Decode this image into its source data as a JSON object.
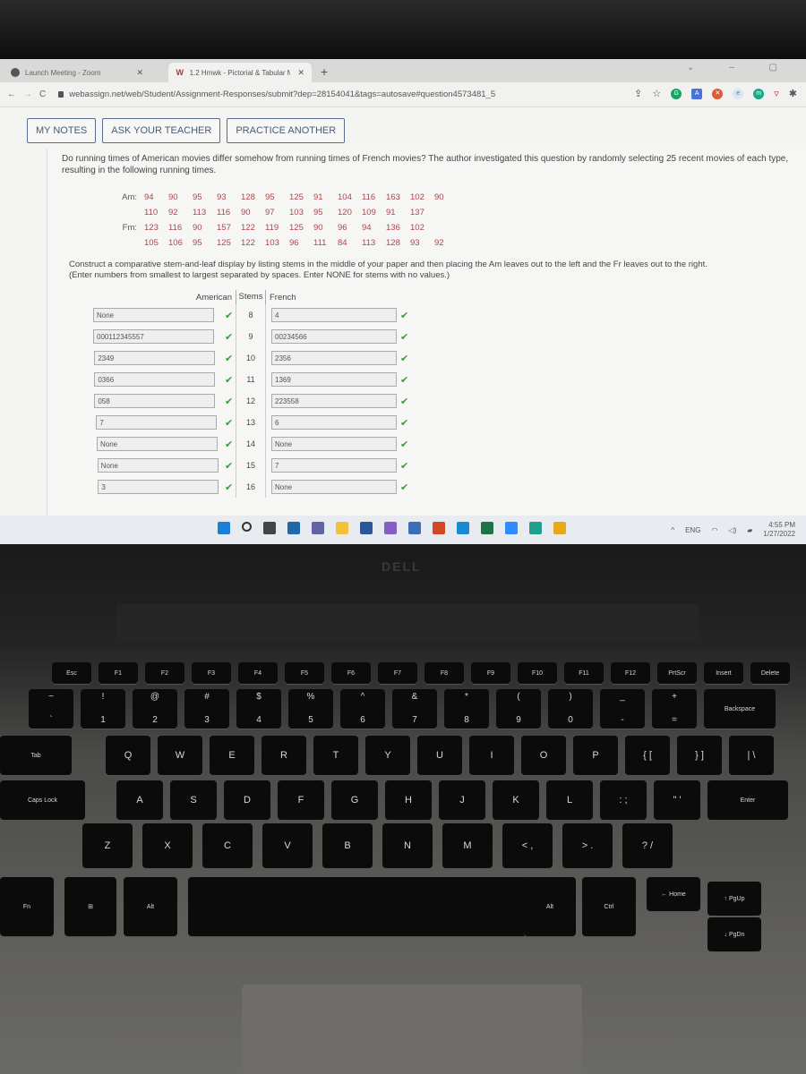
{
  "browser": {
    "tabs": [
      {
        "label": "Launch Meeting - Zoom",
        "active": false
      },
      {
        "label": "1.2 Hmwk - Pictorial & Tabular M",
        "active": true
      }
    ],
    "new_tab": "+",
    "url": "webassign.net/web/Student/Assignment-Responses/submit?dep=28154041&tags=autosave#question4573481_5",
    "extension_colors": [
      "#1aa260",
      "#4a73d9",
      "#e05a3a",
      "#7a9ad6",
      "#1aa88a",
      "#c0394a"
    ]
  },
  "toolbar": {
    "my_notes": "MY NOTES",
    "ask_teacher": "ASK YOUR TEACHER",
    "practice_another": "PRACTICE ANOTHER"
  },
  "question": {
    "text": "Do running times of American movies differ somehow from running times of French movies? The author investigated this question by randomly selecting 25 recent movies of each type, resulting in the following running times.",
    "am_label": "Am:",
    "fm_label": "Fm:",
    "am_rows": [
      [
        "94",
        "90",
        "95",
        "93",
        "128",
        "95",
        "125",
        "91",
        "104",
        "116",
        "163",
        "102",
        "90"
      ],
      [
        "110",
        "92",
        "113",
        "116",
        "90",
        "97",
        "103",
        "95",
        "120",
        "109",
        "91",
        "137"
      ]
    ],
    "fm_rows": [
      [
        "123",
        "116",
        "90",
        "157",
        "122",
        "119",
        "125",
        "90",
        "96",
        "94",
        "136",
        "102"
      ],
      [
        "105",
        "106",
        "95",
        "125",
        "122",
        "103",
        "96",
        "111",
        "84",
        "113",
        "128",
        "93",
        "92"
      ]
    ],
    "instructions": "Construct a comparative stem-and-leaf display by listing stems in the middle of your paper and then placing the Am leaves out to the left and the Fr leaves out to the right.",
    "instructions_note": "(Enter numbers from smallest to largest separated by spaces. Enter NONE for stems with no values.)"
  },
  "stemleaf": {
    "headers": {
      "american": "American",
      "stems": "Stems",
      "french": "French"
    },
    "rows": [
      {
        "american": "None",
        "stem": "8",
        "french": "4"
      },
      {
        "american": "000112345557",
        "stem": "9",
        "french": "00234566"
      },
      {
        "american": "2349",
        "stem": "10",
        "french": "2356"
      },
      {
        "american": "0366",
        "stem": "11",
        "french": "1369"
      },
      {
        "american": "058",
        "stem": "12",
        "french": "223558"
      },
      {
        "american": "7",
        "stem": "13",
        "french": "6"
      },
      {
        "american": "None",
        "stem": "14",
        "french": "None"
      },
      {
        "american": "None",
        "stem": "15",
        "french": "7"
      },
      {
        "american": "3",
        "stem": "16",
        "french": "None"
      }
    ],
    "check_mark": "✔"
  },
  "taskbar": {
    "apps": [
      "windows-start",
      "search",
      "task-view",
      "widgets",
      "teams-chat",
      "file-explorer",
      "word",
      "visual-studio",
      "microsoft-store",
      "powerpoint",
      "mail",
      "excel",
      "zoom",
      "edge",
      "chrome"
    ],
    "app_colors": [
      "#1a7fd6",
      "#333333",
      "#444444",
      "#2266aa",
      "#6264a7",
      "#f2c23a",
      "#2b579a",
      "#865fc5",
      "#3a6fb8",
      "#d24726",
      "#1b8ad6",
      "#217346",
      "#2d8cff",
      "#1f9f8f",
      "#e5a91a"
    ],
    "language": "ENG",
    "time": "4:55 PM",
    "date": "1/27/2022"
  },
  "laptop": {
    "brand": "DELL"
  },
  "keyboard": {
    "fn_row": [
      "Esc",
      "F1",
      "F2",
      "F3",
      "F4",
      "F5",
      "F6",
      "F7",
      "F8",
      "F9",
      "F10",
      "F11",
      "F12",
      "PrtScr",
      "Insert",
      "Delete"
    ],
    "num_row": [
      [
        "~",
        "`"
      ],
      [
        "!",
        "1"
      ],
      [
        "@",
        "2"
      ],
      [
        "#",
        "3"
      ],
      [
        "$",
        "4"
      ],
      [
        "%",
        "5"
      ],
      [
        "^",
        "6"
      ],
      [
        "&",
        "7"
      ],
      [
        "*",
        "8"
      ],
      [
        "(",
        "9"
      ],
      [
        ")",
        "0"
      ],
      [
        "_",
        "-"
      ],
      [
        "+",
        "="
      ],
      [
        "",
        "Backspace"
      ]
    ],
    "top_row": [
      "Tab",
      "Q",
      "W",
      "E",
      "R",
      "T",
      "Y",
      "U",
      "I",
      "O",
      "P",
      "{ [",
      "} ]",
      "| \\"
    ],
    "home_row": [
      "Caps Lock",
      "A",
      "S",
      "D",
      "F",
      "G",
      "H",
      "J",
      "K",
      "L",
      ": ;",
      "\" '",
      "Enter"
    ],
    "bottom_row": [
      "Z",
      "X",
      "C",
      "V",
      "B",
      "N",
      "M",
      "< ,",
      "> .",
      "? /"
    ],
    "space_row": [
      "Fn",
      "⊞",
      "Alt",
      "",
      "Alt",
      "Ctrl",
      "← Home",
      "↑ PgUp",
      "↓ PgDn"
    ]
  }
}
